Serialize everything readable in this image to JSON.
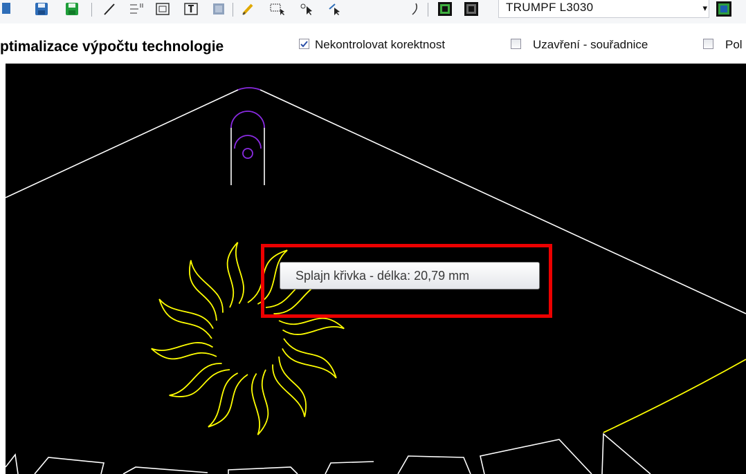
{
  "toolbar": {
    "machine_select": {
      "value": "TRUMPF L3030",
      "arrow": "▾"
    },
    "buttons": [
      {
        "name": "new-icon"
      },
      {
        "name": "save-icon"
      },
      {
        "name": "save-as-icon"
      },
      {
        "name": "line-tool-icon"
      },
      {
        "name": "dimension-icon"
      },
      {
        "name": "image-icon"
      },
      {
        "name": "text-tool-icon"
      },
      {
        "name": "texture-icon"
      },
      {
        "name": "pencil-icon"
      },
      {
        "name": "select-area-icon"
      },
      {
        "name": "select-arrow-icon"
      },
      {
        "name": "select-path-icon"
      },
      {
        "name": "arc-icon"
      },
      {
        "name": "layer-green-icon"
      },
      {
        "name": "layer-dark-icon"
      },
      {
        "name": "machine-config-icon"
      }
    ]
  },
  "options_bar": {
    "title": "ptimalizace výpočtu technologie",
    "checkboxes": [
      {
        "label": "Nekontrolovat korektnost",
        "checked": true
      },
      {
        "label": "Uzavření - souřadnice",
        "checked": false
      },
      {
        "label": "Pol",
        "checked": false
      }
    ]
  },
  "canvas": {
    "background": "#000000",
    "colors": {
      "outline": "#ffffff",
      "spline": "#ffff00",
      "arc": "#8a2be2"
    },
    "tooltip": {
      "text": "Splajn křivka - délka: 20,79 mm"
    },
    "highlight_color": "#ec0000"
  }
}
